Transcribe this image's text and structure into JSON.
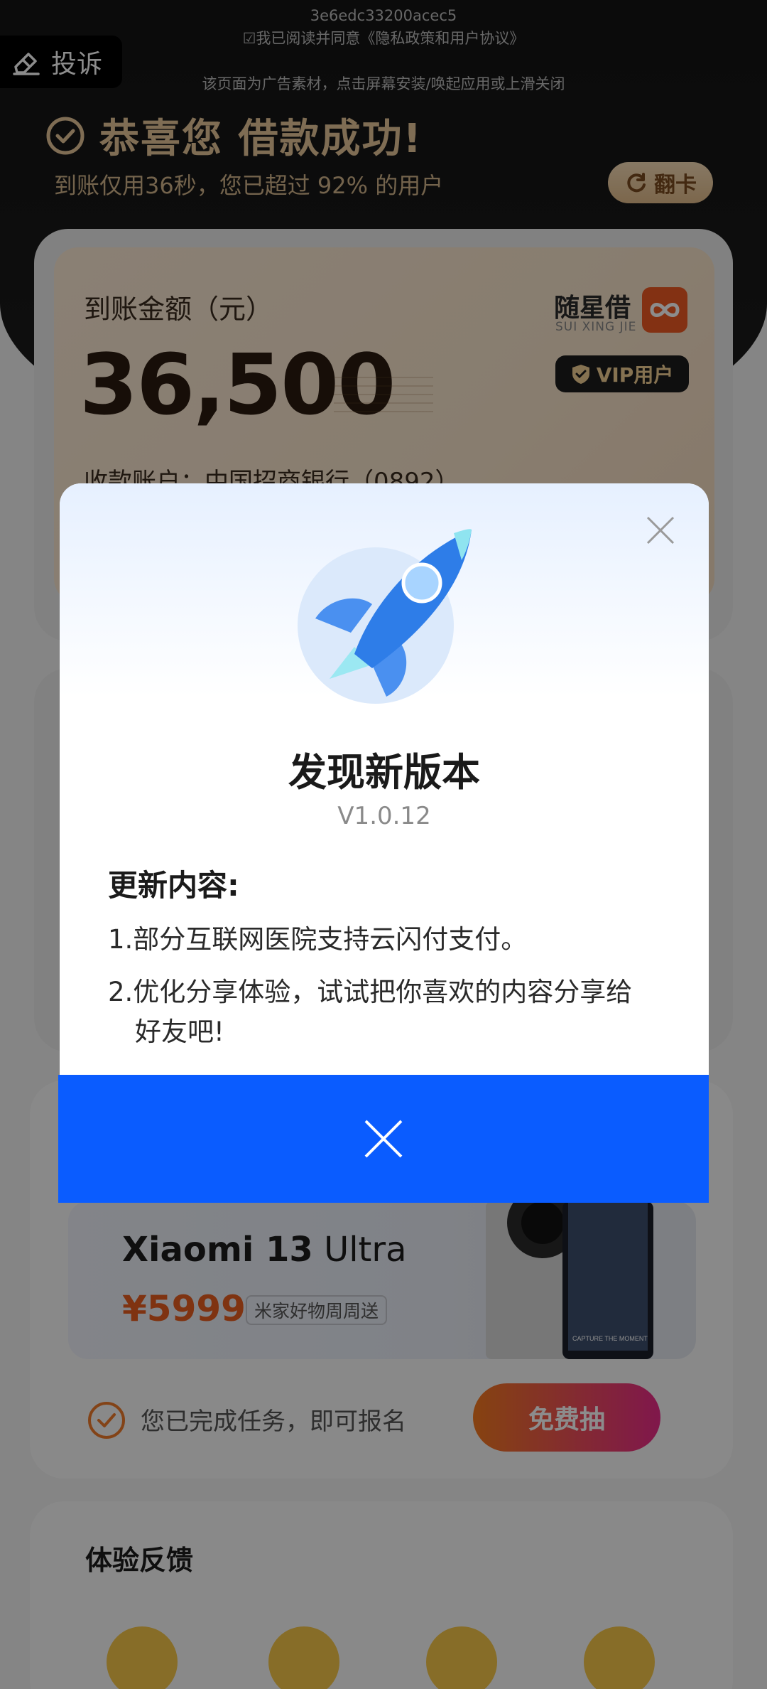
{
  "header": {
    "ad_id": "3e6edc33200acec5",
    "agreement": "☑我已阅读并同意《隐私政策和用户协议》",
    "ad_notice": "该页面为广告素材，点击屏幕安装/唤起应用或上滑关闭",
    "complain_label": "投诉"
  },
  "success": {
    "title": "恭喜您 借款成功!",
    "subtitle": "到账仅用36秒，您已超过 92% 的用户",
    "flip_label": "翻卡"
  },
  "loan_card": {
    "amount_label": "到账金额（元）",
    "amount_value": "36,500",
    "account_line": "收款账户：中国招商银行（0892）",
    "brand_name": "随星借",
    "brand_pinyin": "SUI XING JIE",
    "vip_label": "VIP用户"
  },
  "product": {
    "name_main": "Xiaomi 13",
    "name_suffix": "Ultra",
    "price": "¥5999",
    "tag": "米家好物周周送",
    "phone_caption": "CAPTURE THE MOMENT"
  },
  "task": {
    "text": "您已完成任务，即可报名",
    "button_label": "免费抽"
  },
  "feedback": {
    "title": "体验反馈"
  },
  "dialog": {
    "title": "发现新版本",
    "version": "V1.0.12",
    "subtitle": "更新内容:",
    "item1": "1.部分互联网医院支持云闪付支付。",
    "item2_line1": "2.优化分享体验，试试把你喜欢的内容分享给",
    "item2_line2": "好友吧!"
  },
  "colors": {
    "accent_blue": "#0a5cff",
    "gold": "#e7c79a",
    "price_orange": "#e75d1f"
  }
}
